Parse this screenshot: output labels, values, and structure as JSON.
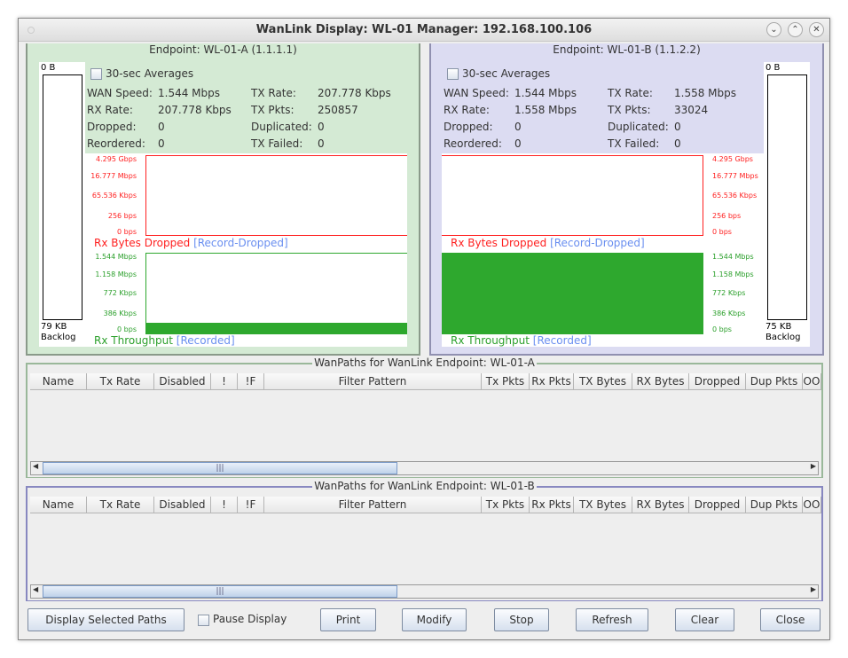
{
  "window": {
    "title": "WanLink Display: WL-01  Manager: 192.168.100.106"
  },
  "colors": {
    "endpoint_a_bg": "#d4ead4",
    "endpoint_b_bg": "#dcdcf2",
    "dropped": "#ff2020",
    "throughput": "#2ea82e",
    "record_link": "#6a8ff0"
  },
  "endpoints": [
    {
      "title": "Endpoint: WL-01-A  (1.1.1.1)",
      "avg_label": "30-sec Averages",
      "backlog_top": "0 B",
      "backlog_bottom": "79 KB",
      "backlog_label": "Backlog",
      "stats": [
        [
          "WAN Speed:",
          "1.544 Mbps",
          "TX Rate:",
          "207.778 Kbps"
        ],
        [
          "RX Rate:",
          "207.778 Kbps",
          "TX Pkts:",
          "250857"
        ],
        [
          "Dropped:",
          "0",
          "Duplicated:",
          "0"
        ],
        [
          "Reordered:",
          "0",
          "TX Failed:",
          "0"
        ]
      ],
      "dropped_title": "Rx Bytes Dropped",
      "dropped_link": "[Record-Dropped]",
      "throughput_title": "Rx Throughput",
      "throughput_link": "[Recorded]",
      "dropped_ticks": [
        "4.295 Gbps",
        "16.777 Mbps",
        "65.536 Kbps",
        "256 bps",
        "0 bps"
      ],
      "throughput_ticks": [
        "1.544 Mbps",
        "1.158 Mbps",
        "772 Kbps",
        "386 Kbps",
        "0 bps"
      ],
      "throughput_fill": 0.135
    },
    {
      "title": "Endpoint: WL-01-B  (1.1.2.2)",
      "avg_label": "30-sec Averages",
      "backlog_top": "0 B",
      "backlog_bottom": "75 KB",
      "backlog_label": "Backlog",
      "stats": [
        [
          "WAN Speed:",
          "1.544 Mbps",
          "TX Rate:",
          "1.558 Mbps"
        ],
        [
          "RX Rate:",
          "1.558 Mbps",
          "TX Pkts:",
          "33024"
        ],
        [
          "Dropped:",
          "0",
          "Duplicated:",
          "0"
        ],
        [
          "Reordered:",
          "0",
          "TX Failed:",
          "0"
        ]
      ],
      "dropped_title": "Rx Bytes Dropped",
      "dropped_link": "[Record-Dropped]",
      "throughput_title": "Rx Throughput",
      "throughput_link": "[Recorded]",
      "dropped_ticks": [
        "4.295 Gbps",
        "16.777 Mbps",
        "65.536 Kbps",
        "256 bps",
        "0 bps"
      ],
      "throughput_ticks": [
        "1.544 Mbps",
        "1.158 Mbps",
        "772 Kbps",
        "386 Kbps",
        "0 bps"
      ],
      "throughput_fill": 1.0
    }
  ],
  "tables": [
    {
      "title": "WanPaths for WanLink Endpoint: WL-01-A"
    },
    {
      "title": "WanPaths for WanLink Endpoint: WL-01-B"
    }
  ],
  "columns": [
    "Name",
    "Tx Rate",
    "Disabled",
    "!",
    "!F",
    "Filter Pattern",
    "Tx Pkts",
    "Rx Pkts",
    "TX Bytes",
    "RX Bytes",
    "Dropped",
    "Dup Pkts",
    "OO"
  ],
  "buttons": {
    "display_selected": "Display Selected Paths",
    "pause": "Pause Display",
    "print": "Print",
    "modify": "Modify",
    "stop": "Stop",
    "refresh": "Refresh",
    "clear": "Clear",
    "close": "Close"
  }
}
